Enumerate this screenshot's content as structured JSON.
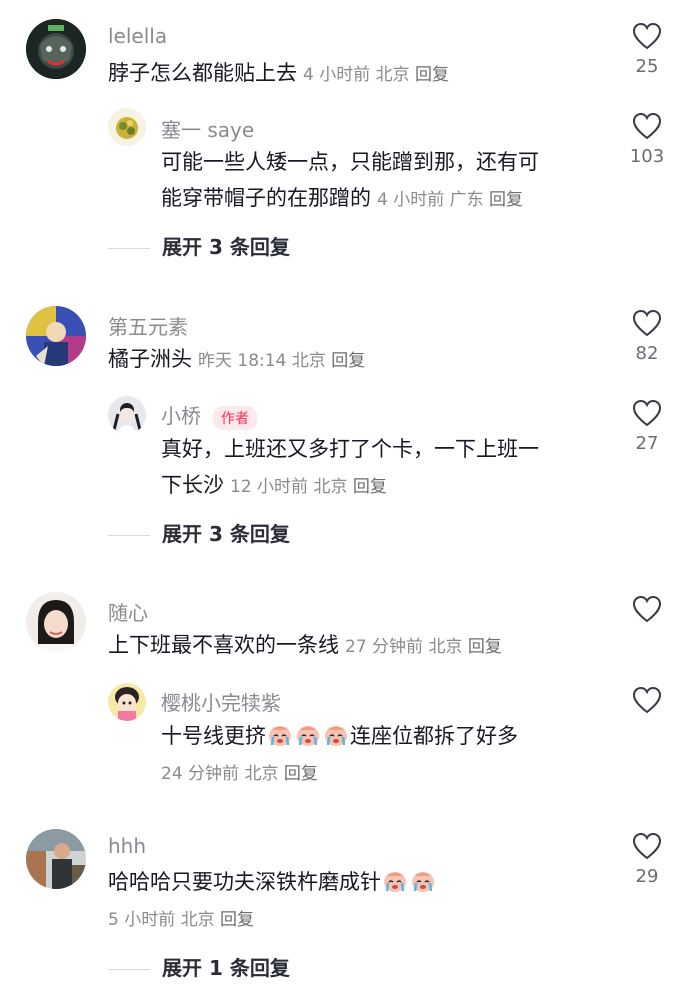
{
  "comments": [
    {
      "user": "lelella",
      "text": "脖子怎么都能贴上去",
      "time": "4 小时前",
      "location": "北京",
      "reply_label": "回复",
      "likes": "25",
      "reply": {
        "user": "塞一 saye",
        "text_line1": "可能一些人矮一点，只能蹭到那，还有可",
        "text_line2": "能穿带帽子的在那蹭的",
        "time": "4 小时前",
        "location": "广东",
        "reply_label": "回复",
        "likes": "103"
      },
      "expand_label": "展开 3 条回复"
    },
    {
      "user": "第五元素",
      "text": "橘子洲头",
      "time": "昨天 18:14",
      "location": "北京",
      "reply_label": "回复",
      "likes": "82",
      "reply": {
        "user": "小桥",
        "badge": "作者",
        "text_line1": "真好，上班还又多打了个卡，一下上班一",
        "text_line2": "下长沙",
        "time": "12 小时前",
        "location": "北京",
        "reply_label": "回复",
        "likes": "27"
      },
      "expand_label": "展开 3 条回复"
    },
    {
      "user": "随心",
      "text": "上下班最不喜欢的一条线",
      "time": "27 分钟前",
      "location": "北京",
      "reply_label": "回复",
      "reply": {
        "user": "樱桃小完犊紫",
        "text_a": "十号线更挤",
        "text_b": "连座位都拆了好多",
        "time": "24 分钟前",
        "location": "北京",
        "reply_label": "回复"
      }
    },
    {
      "user": "hhh",
      "text": "哈哈哈只要功夫深铁杵磨成针",
      "time": "5 小时前",
      "location": "北京",
      "reply_label": "回复",
      "likes": "29",
      "expand_label": "展开 1 条回复"
    }
  ],
  "icons": {
    "like": "heart-outline-icon",
    "cry": "crying-emoji-icon"
  },
  "colors": {
    "meta": "#8a8b91",
    "author_badge": "#fe2c55"
  }
}
